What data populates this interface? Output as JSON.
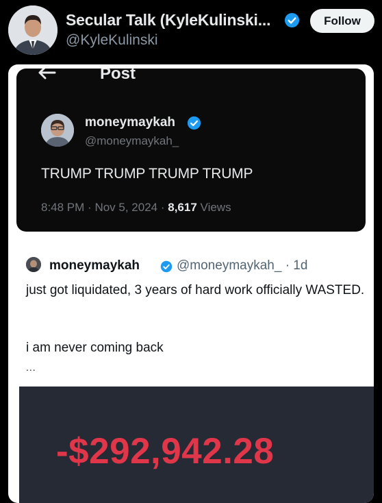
{
  "author": {
    "name": "Secular Talk (KyleKulinski...",
    "handle": "@KyleKulinski",
    "follow_label": "Follow",
    "verified_color": "#1d9bf0"
  },
  "media": {
    "dark_post": {
      "header_label": "Post",
      "name": "moneymaykah",
      "handle": "@moneymaykah_",
      "text": "TRUMP TRUMP TRUMP TRUMP",
      "time": "8:48 PM",
      "date": "Nov 5, 2024",
      "views_count": "8,617",
      "views_label": "Views"
    },
    "quoted_post": {
      "name": "moneymaykah",
      "handle": "@moneymaykah_ · 1d",
      "text": "just got liquidated, 3 years of hard work officially WASTED.",
      "text2": "i am never coming back",
      "ellipsis": "...",
      "loss_amount": "-$292,942.28",
      "loss_color": "#e0364a"
    }
  }
}
